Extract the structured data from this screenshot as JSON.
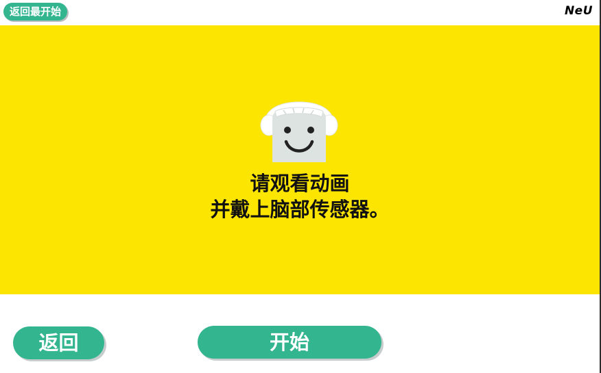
{
  "header": {
    "restart_label": "返回最开始",
    "brand": "NeU"
  },
  "main": {
    "mascot_icon": "smiling-headset-mascot-icon",
    "message_line1": "请观看动画",
    "message_line2": "并戴上脑部传感器。"
  },
  "footer": {
    "back_label": "返回",
    "start_label": "开始"
  },
  "colors": {
    "panel_background": "#fce500",
    "button_green": "#33b58f",
    "button_text": "#ffffff"
  }
}
